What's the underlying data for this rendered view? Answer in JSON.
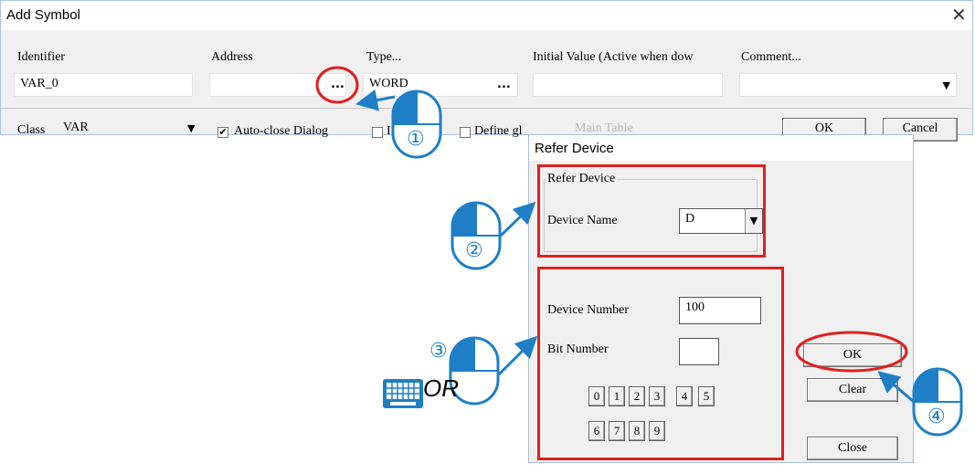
{
  "add_symbol": {
    "title": "Add Symbol",
    "close_glyph": "✕",
    "columns": {
      "identifier": {
        "label": "Identifier",
        "value": "VAR_0"
      },
      "address": {
        "label": "Address",
        "value": "",
        "browse": "..."
      },
      "type": {
        "label": "Type...",
        "value": "WORD",
        "browse": "..."
      },
      "initial_value": {
        "label": "Initial Value (Active when dow",
        "value": ""
      },
      "comment": {
        "label": "Comment...",
        "value": ""
      }
    },
    "class": {
      "label": "Class",
      "value": "VAR"
    },
    "auto_close": {
      "label": "Auto-close Dialog",
      "checked": true
    },
    "unlabeled_checkbox_text": "I",
    "define_global": {
      "label": "Define gl"
    },
    "table_select": "Main Table",
    "ok_label": "OK",
    "cancel_label": "Cancel"
  },
  "refer_device": {
    "title": "Refer Device",
    "group_label": "Refer Device",
    "device_name_label": "Device Name",
    "device_name_value": "D",
    "device_number_label": "Device Number",
    "device_number_value": "100",
    "bit_number_label": "Bit Number",
    "bit_number_value": "",
    "digits_row1": [
      "0",
      "1",
      "2",
      "3",
      "4",
      "5"
    ],
    "digits_row2": [
      "6",
      "7",
      "8",
      "9"
    ],
    "ok_label": "OK",
    "clear_label": "Clear",
    "close_label": "Close"
  },
  "annotations": {
    "step1": "①",
    "step2": "②",
    "step3": "③",
    "step4": "④",
    "or_text": "OR"
  },
  "colors": {
    "highlight_red": "#e02020",
    "arrow_blue": "#1e7fc6",
    "mouse_fill": "#1e7fc6"
  }
}
